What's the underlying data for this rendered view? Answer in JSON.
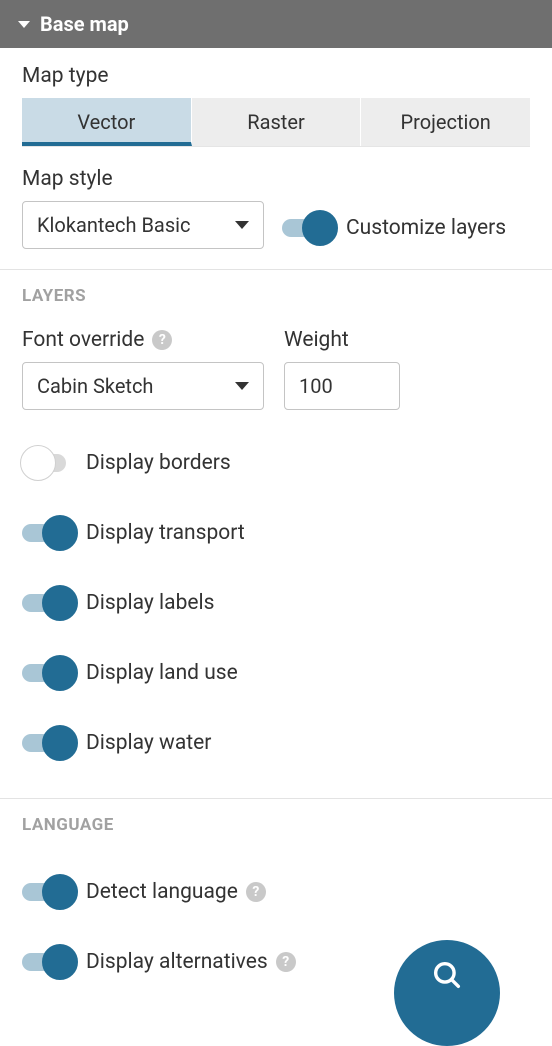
{
  "header": {
    "title": "Base map"
  },
  "mapType": {
    "label": "Map type",
    "tabs": [
      "Vector",
      "Raster",
      "Projection"
    ],
    "active": "Vector"
  },
  "mapStyle": {
    "label": "Map style",
    "value": "Klokantech Basic",
    "customizeLabel": "Customize layers",
    "customizeOn": true
  },
  "layers": {
    "heading": "Layers",
    "fontOverride": {
      "label": "Font override",
      "value": "Cabin Sketch"
    },
    "weight": {
      "label": "Weight",
      "value": "100"
    },
    "toggles": [
      {
        "label": "Display borders",
        "on": false
      },
      {
        "label": "Display transport",
        "on": true
      },
      {
        "label": "Display labels",
        "on": true
      },
      {
        "label": "Display land use",
        "on": true
      },
      {
        "label": "Display water",
        "on": true
      }
    ]
  },
  "language": {
    "heading": "Language",
    "toggles": [
      {
        "label": "Detect language",
        "on": true,
        "help": true
      },
      {
        "label": "Display alternatives",
        "on": true,
        "help": true
      }
    ]
  },
  "helpGlyph": "?"
}
